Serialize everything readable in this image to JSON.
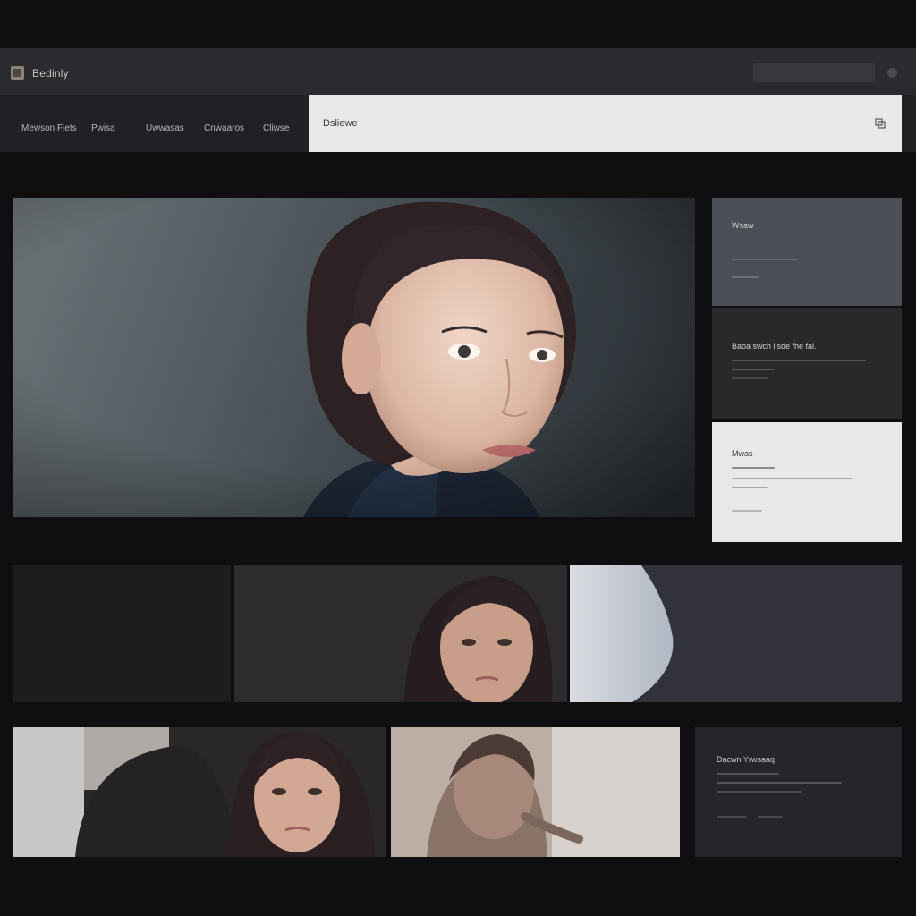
{
  "app": {
    "title": "Bedinly"
  },
  "nav": {
    "items": [
      "Mewson Fiets",
      "Pwisa",
      "Uwwasas",
      "Cnwaaros",
      "Cliwse"
    ]
  },
  "search": {
    "placeholder": "Dsliewe"
  },
  "colors": {
    "background": "#0f0e10",
    "appbar": "#2b2a2e",
    "navbar": "#212024",
    "search_box": "#e9e8e9",
    "card_slate": "#4a4f55",
    "card_dark": "#29282a",
    "card_light": "#e9e8e9"
  },
  "icons": {
    "app": "app-logo-icon",
    "search": "search-icon",
    "user": "user-icon"
  },
  "cards": {
    "card1": {
      "title": "Wsaw"
    },
    "card2": {
      "title": "Baoa swch iisde fhe fal."
    },
    "card3": {
      "title": "Mwas"
    },
    "card4": {
      "title": "Dacwn Yrwsaaq"
    }
  }
}
